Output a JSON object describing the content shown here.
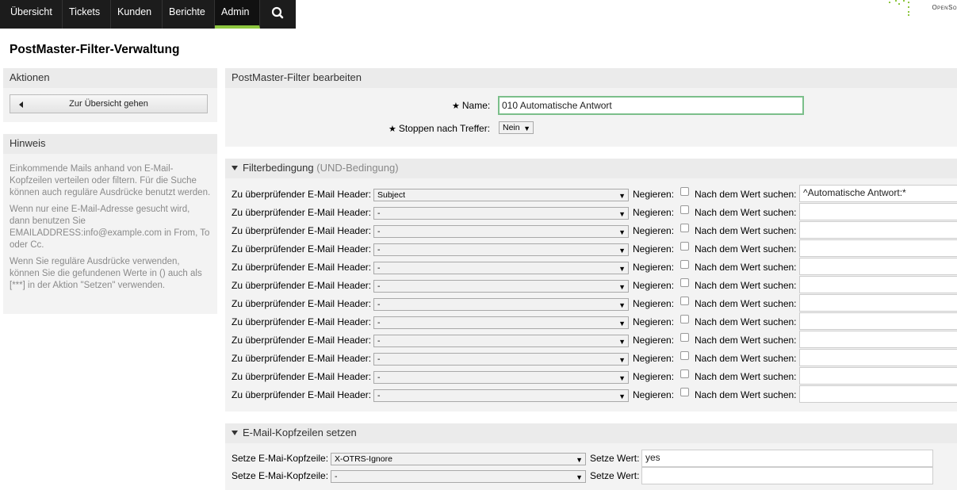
{
  "nav": {
    "items": [
      "Übersicht",
      "Tickets",
      "Kunden",
      "Berichte",
      "Admin"
    ],
    "active": "Admin",
    "search_icon": "search-icon",
    "logo_text": "OpenSo",
    "accent": "#8dc63f"
  },
  "page_title": "PostMaster-Filter-Verwaltung",
  "actions": {
    "title": "Aktionen",
    "overview_button": "Zur Übersicht gehen"
  },
  "hint": {
    "title": "Hinweis",
    "paragraphs": [
      "Einkommende Mails anhand von E-Mail-Kopfzeilen verteilen oder filtern. Für die Suche können auch reguläre Ausdrücke benutzt werden.",
      "Wenn nur eine E-Mail-Adresse gesucht wird, dann benutzen Sie EMAILADDRESS:info@example.com in From, To oder Cc.",
      "Wenn Sie reguläre Ausdrücke verwenden, können Sie die gefundenen Werte in () auch als [***] in der Aktion \"Setzen\" verwenden."
    ]
  },
  "edit": {
    "title": "PostMaster-Filter bearbeiten",
    "name_label": "Name:",
    "name_value": "010 Automatische Antwort",
    "stop_label": "Stoppen nach Treffer:",
    "stop_value": "Nein"
  },
  "filter": {
    "title": "Filterbedingung",
    "subtitle": "(UND-Bedingung)",
    "header_label": "Zu überprüfender E-Mail Header:",
    "negate_label": "Negieren:",
    "search_label": "Nach dem Wert suchen:",
    "rows": [
      {
        "header": "Subject",
        "value": "^Automatische Antwort:*"
      },
      {
        "header": "-",
        "value": ""
      },
      {
        "header": "-",
        "value": ""
      },
      {
        "header": "-",
        "value": ""
      },
      {
        "header": "-",
        "value": ""
      },
      {
        "header": "-",
        "value": ""
      },
      {
        "header": "-",
        "value": ""
      },
      {
        "header": "-",
        "value": ""
      },
      {
        "header": "-",
        "value": ""
      },
      {
        "header": "-",
        "value": ""
      },
      {
        "header": "-",
        "value": ""
      },
      {
        "header": "-",
        "value": ""
      }
    ]
  },
  "set": {
    "title": "E-Mail-Kopfzeilen setzen",
    "header_label": "Setze E-Mai-Kopfzeile:",
    "value_label": "Setze Wert:",
    "rows": [
      {
        "header": "X-OTRS-Ignore",
        "value": "yes"
      },
      {
        "header": "-",
        "value": ""
      }
    ]
  }
}
